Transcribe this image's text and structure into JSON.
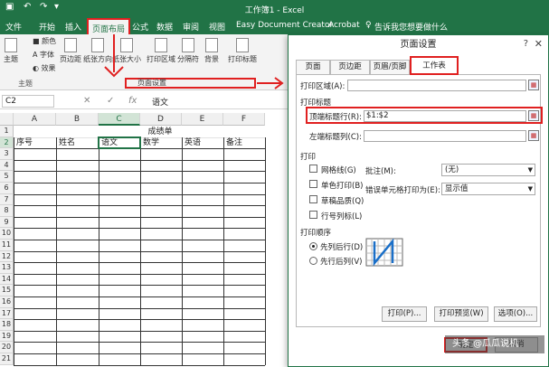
{
  "window": {
    "title": "工作簿1 - Excel"
  },
  "tabs": [
    {
      "label": "文件"
    },
    {
      "label": "开始"
    },
    {
      "label": "插入"
    },
    {
      "label": "页面布局",
      "active": true
    },
    {
      "label": "公式"
    },
    {
      "label": "数据"
    },
    {
      "label": "审阅"
    },
    {
      "label": "视图"
    },
    {
      "label": "Easy Document Creator"
    },
    {
      "label": "Acrobat"
    }
  ],
  "tellme": "告诉我您想要做什么",
  "ribbon": {
    "buttons": [
      "主题",
      "页边距",
      "纸张方向",
      "纸张大小",
      "打印区域",
      "分隔符",
      "背景",
      "打印标题"
    ],
    "mini": [
      "颜色",
      "字体",
      "效果"
    ],
    "group_theme": "主题",
    "group_pagesetup": "页面设置"
  },
  "formula_bar": {
    "namebox": "C2",
    "fx": "fx",
    "value": "语文"
  },
  "grid": {
    "columns": [
      "A",
      "B",
      "C",
      "D",
      "E",
      "F"
    ],
    "rows": [
      "1",
      "2",
      "3",
      "4",
      "5",
      "6",
      "7",
      "8",
      "9",
      "10",
      "11",
      "12",
      "13",
      "14",
      "15",
      "16",
      "17",
      "18",
      "19",
      "20",
      "21"
    ],
    "title": "成绩单",
    "headers": [
      "序号",
      "姓名",
      "语文",
      "数学",
      "英语",
      "备注"
    ]
  },
  "dialog": {
    "title": "页面设置",
    "help": "?",
    "close": "✕",
    "tabs": [
      "页面",
      "页边距",
      "页眉/页脚",
      "工作表"
    ],
    "print_area_label": "打印区域(A):",
    "print_area_value": "",
    "print_titles_label": "打印标题",
    "top_rows_label": "顶端标题行(R):",
    "top_rows_value": "$1:$2",
    "left_cols_label": "左端标题列(C):",
    "left_cols_value": "",
    "print_label": "打印",
    "checkboxes": [
      "网格线(G)",
      "单色打印(B)",
      "草稿品质(Q)",
      "行号列标(L)"
    ],
    "comments_label": "批注(M):",
    "comments_value": "(无)",
    "errors_label": "错误单元格打印为(E):",
    "errors_value": "显示值",
    "order_label": "打印顺序",
    "order_options": [
      "先列后行(D)",
      "先行后列(V)"
    ],
    "buttons": [
      "打印(P)...",
      "打印预览(W)",
      "选项(O)..."
    ],
    "ok": "确定",
    "cancel": "取消"
  },
  "watermark": "头条 @瓜瓜说机"
}
